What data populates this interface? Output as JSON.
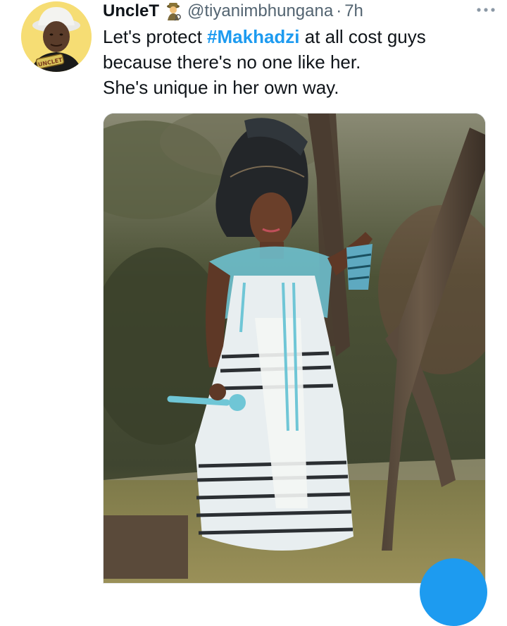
{
  "tweet": {
    "author": {
      "display_name": "UncleT",
      "badge_emoji": "detective-emoji",
      "handle": "@tiyanimbhungana",
      "separator": "·",
      "time": "7h",
      "avatar_text": "UNCLET"
    },
    "more_icon": "more-icon",
    "text_lines": {
      "line1_pre": "Let's protect ",
      "hashtag": "#Makhadzi",
      "line1_post": " at all cost guys",
      "line2": "because there's no one like her.",
      "line3": "She's unique in her own way."
    },
    "media": {
      "description_icon": "photo",
      "colors": {
        "foliage": "#4a4f34",
        "grass": "#8a8450",
        "trunk": "#5a4a3c",
        "turban": "#232629",
        "beads": "#6fc6d6",
        "dress": "#e8eef0",
        "stripes": "#2b2f33"
      }
    }
  },
  "compose_button": {
    "icon": "compose-icon",
    "color": "#1d9bf0"
  }
}
